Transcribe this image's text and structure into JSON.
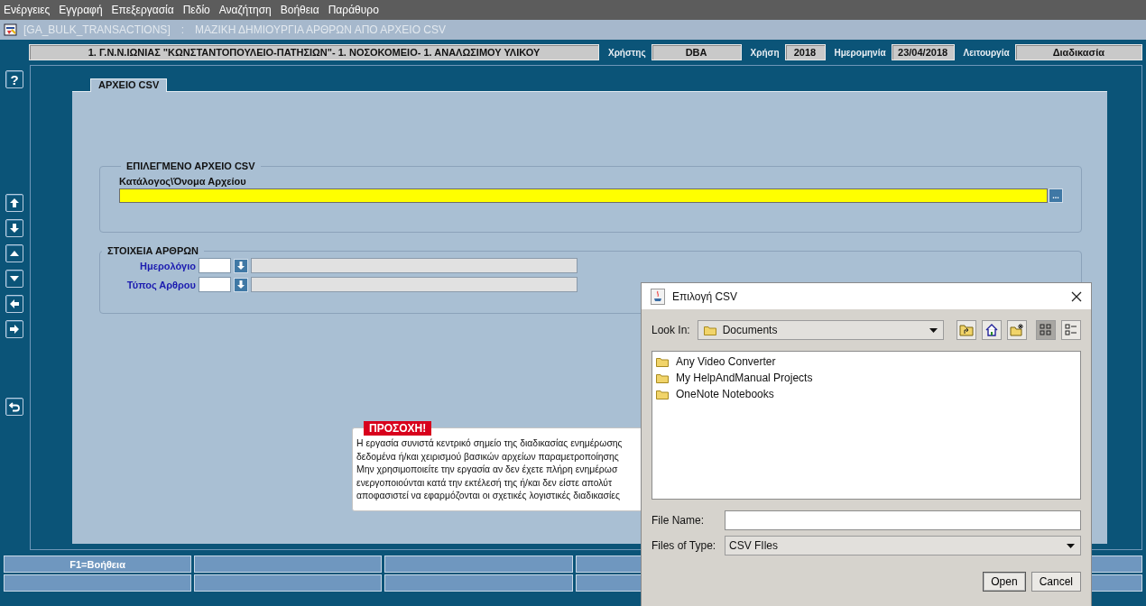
{
  "menu": [
    "Ενέργειες",
    "Εγγραφή",
    "Επεξεργασία",
    "Πεδίο",
    "Αναζήτηση",
    "Βοήθεια",
    "Παράθυρο"
  ],
  "window": {
    "code": "[GA_BULK_TRANSACTIONS]",
    "separator": ":",
    "title": "ΜΑΖΙΚΗ ΔΗΜΙΟΥΡΓΙΑ ΑΡΘΡΩΝ ΑΠΟ ΑΡΧΕΙΟ CSV"
  },
  "header": {
    "organization": "1. Γ.Ν.Ν.ΙΩΝΙΑΣ \"ΚΩΝΣΤΑΝΤΟΠΟΥΛΕΙΟ-ΠΑΤΗΣΙΩΝ\"- 1. ΝΟΣΟΚΟΜΕΙΟ- 1. ΑΝΑΛΩΣΙΜΟΥ ΥΛΙΚΟΥ",
    "fields": [
      {
        "label": "Χρήστης",
        "value": "DBA"
      },
      {
        "label": "Χρήση",
        "value": "2018"
      },
      {
        "label": "Ημερομηνία",
        "value": "23/04/2018"
      },
      {
        "label": "Λειτουργία",
        "value": "Διαδικασία"
      }
    ]
  },
  "toolbar": [
    [
      {
        "kind": "help",
        "label": "?"
      }
    ],
    [
      {
        "kind": "up"
      },
      {
        "kind": "down"
      },
      {
        "kind": "prev"
      },
      {
        "kind": "next"
      },
      {
        "kind": "left"
      },
      {
        "kind": "right"
      }
    ],
    [
      {
        "kind": "return"
      }
    ]
  ],
  "tabs": [
    {
      "label": "ΑΡΧΕΙΟ CSV",
      "selected": true
    }
  ],
  "file_section": {
    "title": "ΕΠΙΛΕΓΜΕΝΟ ΑΡΧΕΙΟ CSV",
    "label": "Κατάλογος\\Όνομα Αρχείου",
    "focused": true,
    "browse": "..."
  },
  "items_section": {
    "title": "ΣΤΟΙΧΕΙΑ ΑΡΘΡΩΝ",
    "rows": [
      {
        "label": "Ημερολόγιο"
      },
      {
        "label": "Τύπος Αρθρου"
      }
    ]
  },
  "warning": {
    "title": "ΠΡΟΣΟΧΗ!",
    "lines": [
      "Η εργασία συνιστά κεντρικό σημείο της διαδικασίας ενημέρωσης",
      "δεδομένα ή/και χειρισμού βασικών αρχείων παραμετροποίησης",
      "Μην χρησιμοποιείτε την εργασία αν δεν έχετε πλήρη ενημέρωσ",
      "ενεργοποιούνται κατά την εκτέλεσή της ή/και δεν είστε απολύτ",
      "αποφασιστεί να εφαρμόζονται οι σχετικές λογιστικές διαδικασίες"
    ]
  },
  "status_bar": {
    "help": "F1=Βοήθεια"
  },
  "dialog": {
    "title": "Επιλογή CSV",
    "look_in_label": "Look In:",
    "look_in": "Documents",
    "tools": [
      {
        "kind": "up-folder",
        "selected": false
      },
      {
        "kind": "home",
        "selected": false
      },
      {
        "kind": "new-folder",
        "selected": false
      },
      {
        "kind": "list",
        "selected": true
      },
      {
        "kind": "details",
        "selected": false
      }
    ],
    "files": [
      {
        "name": "Any Video Converter"
      },
      {
        "name": "My HelpAndManual Projects"
      },
      {
        "name": "OneNote Notebooks"
      }
    ],
    "file_name_label": "File Name:",
    "file_type_label": "Files of Type:",
    "file_type": "CSV FIles",
    "buttons": [
      "Open",
      "Cancel"
    ]
  }
}
